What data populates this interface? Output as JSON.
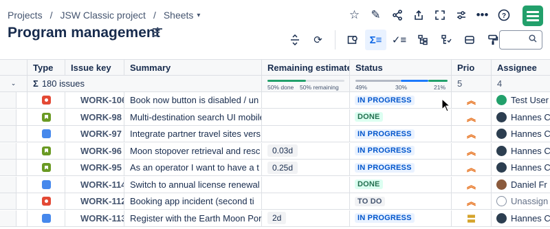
{
  "breadcrumb": {
    "projects": "Projects",
    "sep1": "/",
    "project": "JSW Classic project",
    "sep2": "/",
    "sheets": "Sheets"
  },
  "page_title": "Program management",
  "top_icons": [
    "star-icon",
    "edit-icon",
    "share-icon",
    "export-icon",
    "fullscreen-icon",
    "settings-sliders-icon",
    "more-icon",
    "help-icon"
  ],
  "toolbar_icons": [
    "collapse-rows-icon",
    "refresh-icon",
    "view-icon",
    "sum-icon",
    "checklist-icon",
    "hierarchy-icon",
    "hierarchy-filter-icon",
    "row-height-icon",
    "format-paint-icon"
  ],
  "columns": {
    "type": "Type",
    "key": "Issue key",
    "summary": "Summary",
    "estimate": "Remaining estimate",
    "status": "Status",
    "prio": "Prio",
    "assignee": "Assignee"
  },
  "summary_row": {
    "sigma": "Σ",
    "issues": "180 issues",
    "estimate_done": "50% done",
    "estimate_remaining": "50% remaining",
    "estimate_done_fraction": 0.5,
    "status_todo_pct": "49%",
    "status_progress_pct": "30%",
    "status_done_pct": "21%",
    "status_todo_fraction": 0.49,
    "status_progress_fraction": 0.3,
    "status_done_fraction": 0.21,
    "prio_count": "5",
    "assignee_count": "4"
  },
  "rows": [
    {
      "type": "bug",
      "key": "WORK-106",
      "summary": "Book now button is disabled / un",
      "estimate": "",
      "status": "IN PROGRESS",
      "prio": "high",
      "assignee": "Test User",
      "avatar": "green"
    },
    {
      "type": "story",
      "key": "WORK-98",
      "summary": "Multi-destination search UI mobile",
      "estimate": "",
      "status": "DONE",
      "prio": "high",
      "assignee": "Hannes C",
      "avatar": "dark"
    },
    {
      "type": "task",
      "key": "WORK-97",
      "summary": "Integrate partner travel sites vers",
      "estimate": "",
      "status": "IN PROGRESS",
      "prio": "high",
      "assignee": "Hannes C",
      "avatar": "dark"
    },
    {
      "type": "story",
      "key": "WORK-96",
      "summary": "Moon stopover retrieval and resc",
      "estimate": "0.03d",
      "status": "IN PROGRESS",
      "prio": "high",
      "assignee": "Hannes C",
      "avatar": "dark"
    },
    {
      "type": "story",
      "key": "WORK-95",
      "summary": "As an operator I want to have a t",
      "estimate": "0.25d",
      "status": "IN PROGRESS",
      "prio": "high",
      "assignee": "Hannes C",
      "avatar": "dark"
    },
    {
      "type": "task",
      "key": "WORK-114",
      "summary": "Switch to annual license renewal",
      "estimate": "",
      "status": "DONE",
      "prio": "high",
      "assignee": "Daniel Fr",
      "avatar": "brown"
    },
    {
      "type": "bug",
      "key": "WORK-112",
      "summary": "Booking app incident (second ti",
      "estimate": "",
      "status": "TO DO",
      "prio": "high",
      "assignee": "Unassign",
      "avatar": "empty"
    },
    {
      "type": "task",
      "key": "WORK-113",
      "summary": "Register with the Earth Moon Por",
      "estimate": "2d",
      "status": "IN PROGRESS",
      "prio": "medium",
      "assignee": "Hannes C",
      "avatar": "dark"
    }
  ]
}
